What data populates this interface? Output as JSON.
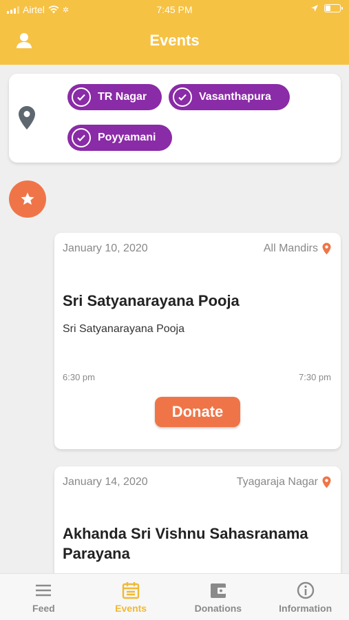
{
  "status": {
    "carrier": "Airtel",
    "time": "7:45 PM"
  },
  "header": {
    "title": "Events"
  },
  "locations": [
    "TR Nagar",
    "Vasanthapura",
    "Poyyamani"
  ],
  "events": [
    {
      "date": "January 10, 2020",
      "location": "All Mandirs",
      "title": "Sri Satyanarayana Pooja",
      "description": "Sri Satyanarayana Pooja",
      "start_time": "6:30 pm",
      "end_time": "7:30 pm",
      "button": "Donate"
    },
    {
      "date": "January 14, 2020",
      "location": "Tyagaraja Nagar",
      "title": "Akhanda Sri Vishnu Sahasranama Parayana"
    }
  ],
  "tabs": [
    "Feed",
    "Events",
    "Donations",
    "Information"
  ],
  "colors": {
    "header": "#f6c244",
    "accent": "#ef7548",
    "chip": "#8a2ba7",
    "active_tab": "#f0b934"
  }
}
